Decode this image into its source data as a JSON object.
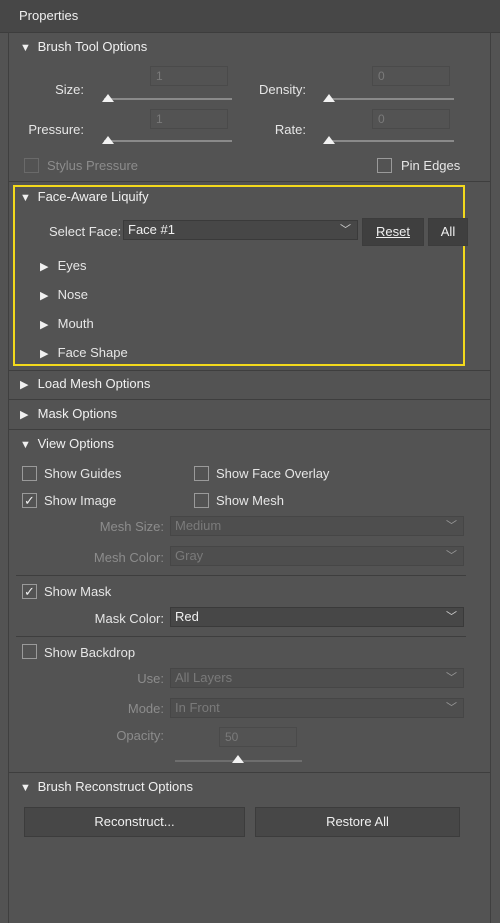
{
  "panel": {
    "title": "Properties"
  },
  "brush_tool": {
    "header": "Brush Tool Options",
    "size_label": "Size:",
    "size_value": "1",
    "density_label": "Density:",
    "density_value": "0",
    "pressure_label": "Pressure:",
    "pressure_value": "1",
    "rate_label": "Rate:",
    "rate_value": "0",
    "stylus_label": "Stylus Pressure",
    "pin_edges_label": "Pin Edges"
  },
  "face_aware": {
    "header": "Face-Aware Liquify",
    "select_face_label": "Select Face:",
    "select_face_value": "Face #1",
    "reset_label": "Reset",
    "all_label": "All",
    "groups": [
      "Eyes",
      "Nose",
      "Mouth",
      "Face Shape"
    ]
  },
  "load_mesh": {
    "header": "Load Mesh Options"
  },
  "mask_options": {
    "header": "Mask Options"
  },
  "view_options": {
    "header": "View Options",
    "show_guides": "Show Guides",
    "show_face_overlay": "Show Face Overlay",
    "show_image": "Show Image",
    "show_mesh": "Show Mesh",
    "mesh_size_label": "Mesh Size:",
    "mesh_size_value": "Medium",
    "mesh_color_label": "Mesh Color:",
    "mesh_color_value": "Gray",
    "show_mask": "Show Mask",
    "mask_color_label": "Mask Color:",
    "mask_color_value": "Red",
    "show_backdrop": "Show Backdrop",
    "use_label": "Use:",
    "use_value": "All Layers",
    "mode_label": "Mode:",
    "mode_value": "In Front",
    "opacity_label": "Opacity:",
    "opacity_value": "50"
  },
  "reconstruct": {
    "header": "Brush Reconstruct Options",
    "reconstruct_label": "Reconstruct...",
    "restore_all_label": "Restore All"
  },
  "colors": {
    "highlight": "#f3d91c",
    "panel_bg": "#535353"
  }
}
